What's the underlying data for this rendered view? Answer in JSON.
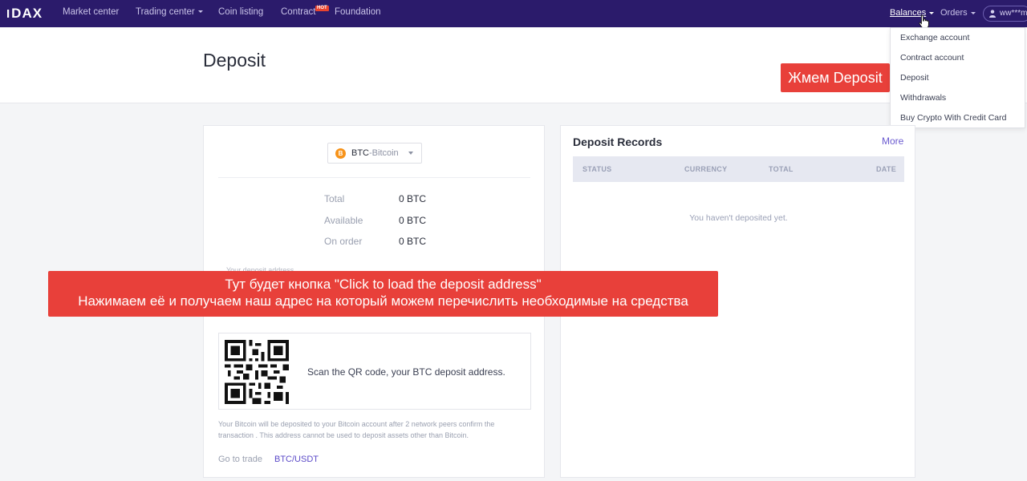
{
  "brand": {
    "logo_text": "DAX",
    "logo_prefix": "I"
  },
  "nav": {
    "market_center": "Market center",
    "trading_center": "Trading center",
    "coin_listing": "Coin listing",
    "contract": "Contract",
    "hot_badge": "HOT",
    "foundation": "Foundation",
    "balances": "Balances",
    "orders": "Orders",
    "user": "ww***m"
  },
  "balances_menu": {
    "items": [
      "Exchange account",
      "Contract account",
      "Deposit",
      "Withdrawals",
      "Buy Crypto With Credit Card"
    ]
  },
  "page": {
    "title": "Deposit"
  },
  "annotations": {
    "small_note": "Жмем Deposit",
    "banner_line1": "Тут будет кнопка \"Click to load the deposit address\"",
    "banner_line2": "Нажимаем её и получаем наш адрес на который можем перечислить необходимые на средства"
  },
  "deposit": {
    "coin_icon": "B",
    "coin_code": "BTC",
    "coin_name": "-Bitcoin",
    "stats": [
      {
        "label": "Total",
        "value": "0 BTC"
      },
      {
        "label": "Available",
        "value": "0 BTC"
      },
      {
        "label": "On order",
        "value": "0 BTC"
      }
    ],
    "address_label": "Your deposit address",
    "qr_text": "Scan the QR code, your BTC deposit address.",
    "note": "Your Bitcoin will be deposited to your Bitcoin account after 2 network peers confirm the transaction . This address cannot be used to deposit assets other than Bitcoin.",
    "go_to_trade": "Go to trade",
    "pair": "BTC/USDT"
  },
  "records": {
    "title": "Deposit Records",
    "more": "More",
    "columns": [
      "STATUS",
      "CURRENCY",
      "TOTAL",
      "DATE"
    ],
    "empty": "You haven't deposited yet."
  },
  "colors": {
    "nav_bg": "#2b1b6b",
    "accent": "#5b4ac8",
    "annotation_red": "#e8403a",
    "btc_orange": "#f7931a"
  }
}
